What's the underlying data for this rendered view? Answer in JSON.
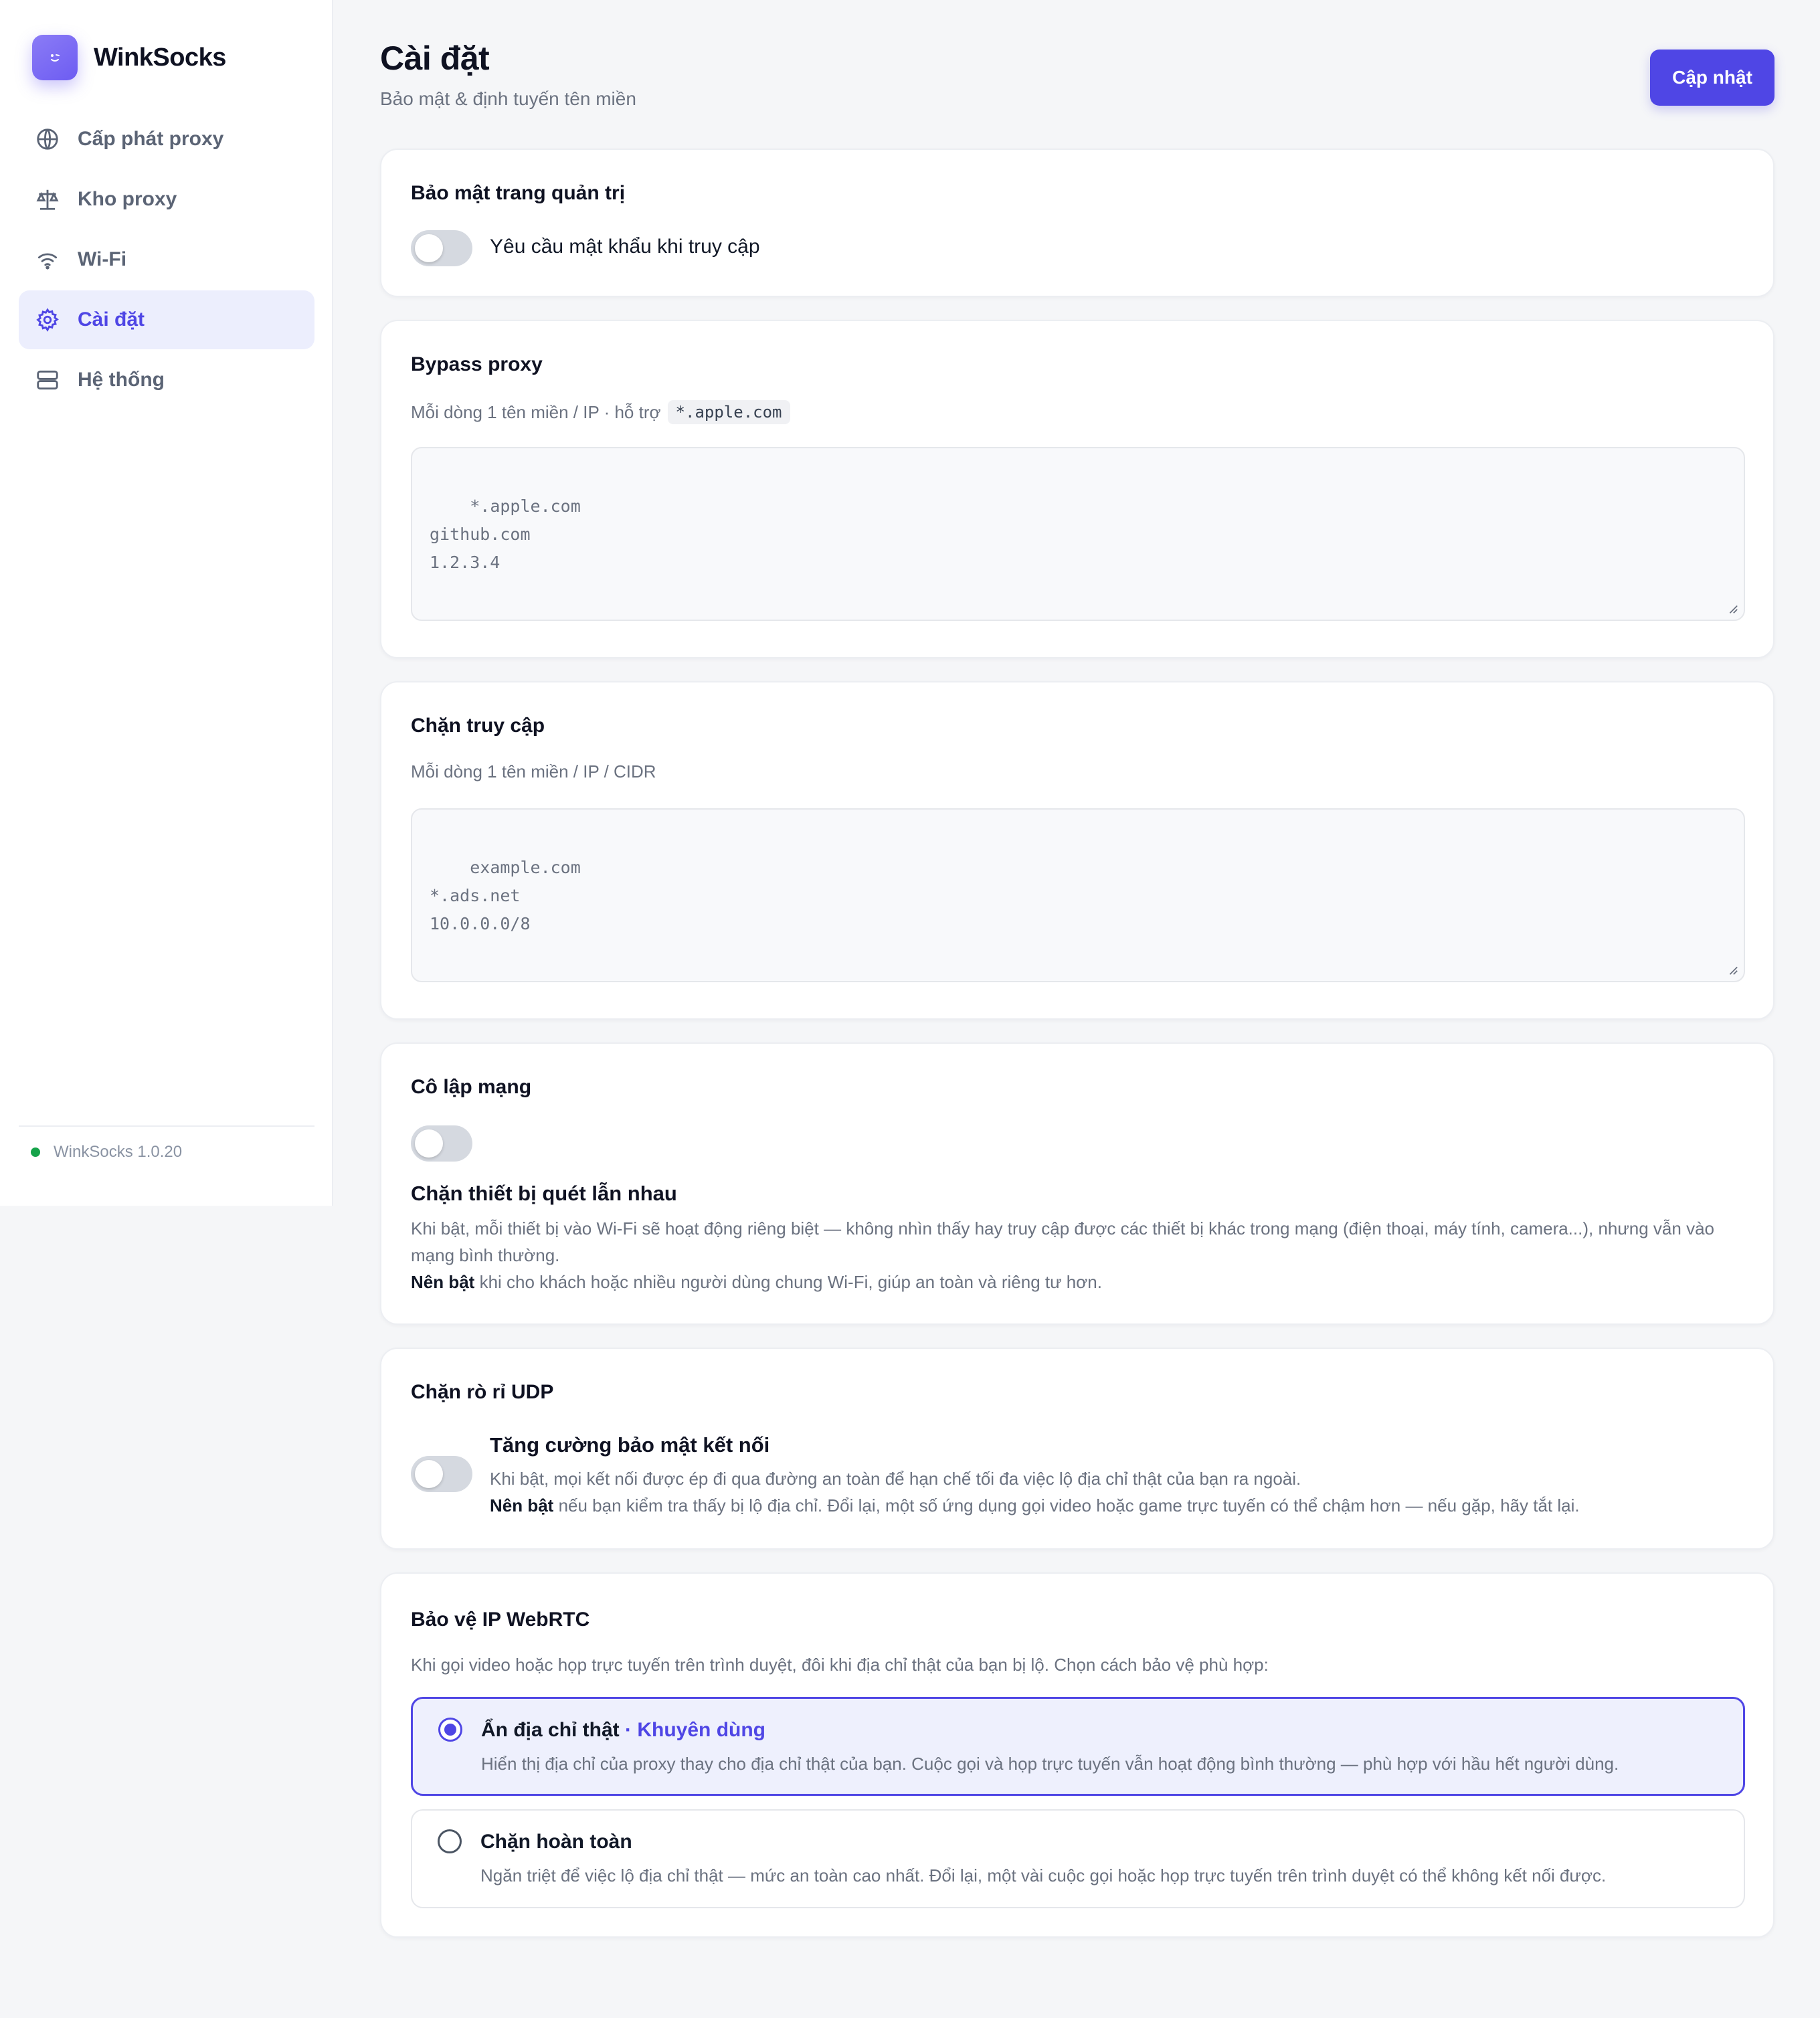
{
  "brand": {
    "name": "WinkSocks",
    "logo_icon": "wink-face-icon"
  },
  "sidebar": {
    "items": [
      {
        "label": "Cấp phát proxy",
        "icon": "globe-icon",
        "active": false
      },
      {
        "label": "Kho proxy",
        "icon": "scale-icon",
        "active": false
      },
      {
        "label": "Wi-Fi",
        "icon": "wifi-icon",
        "active": false
      },
      {
        "label": "Cài đặt",
        "icon": "gear-icon",
        "active": true
      },
      {
        "label": "Hệ thống",
        "icon": "server-icon",
        "active": false
      }
    ],
    "version": "WinkSocks 1.0.20",
    "status_color": "#16a34a"
  },
  "header": {
    "title": "Cài đặt",
    "subtitle": "Bảo mật & định tuyến tên miền",
    "update_label": "Cập nhật"
  },
  "admin_security": {
    "title": "Bảo mật trang quản trị",
    "toggle_label": "Yêu cầu mật khẩu khi truy cập",
    "enabled": false
  },
  "bypass": {
    "title": "Bypass proxy",
    "hint": "Mỗi dòng 1 tên miền / IP · hỗ trợ",
    "hint_code": "*.apple.com",
    "placeholder": "*.apple.com\ngithub.com\n1.2.3.4"
  },
  "block": {
    "title": "Chặn truy cập",
    "hint": "Mỗi dòng 1 tên miền / IP / CIDR",
    "placeholder": "example.com\n*.ads.net\n10.0.0.0/8"
  },
  "isolation": {
    "title": "Cô lập mạng",
    "enabled": false,
    "subtitle": "Chặn thiết bị quét lẫn nhau",
    "desc": "Khi bật, mỗi thiết bị vào Wi-Fi sẽ hoạt động riêng biệt — không nhìn thấy hay truy cập được các thiết bị khác trong mạng (điện thoại, máy tính, camera...), nhưng vẫn vào mạng bình thường.",
    "rec_bold": "Nên bật",
    "rec_text": " khi cho khách hoặc nhiều người dùng chung Wi-Fi, giúp an toàn và riêng tư hơn."
  },
  "udp": {
    "title": "Chặn rò rỉ UDP",
    "enabled": false,
    "subtitle": "Tăng cường bảo mật kết nối",
    "desc": "Khi bật, mọi kết nối được ép đi qua đường an toàn để hạn chế tối đa việc lộ địa chỉ thật của bạn ra ngoài.",
    "rec_bold": "Nên bật",
    "rec_text": " nếu bạn kiểm tra thấy bị lộ địa chỉ. Đổi lại, một số ứng dụng gọi video hoặc game trực tuyến có thể chậm hơn — nếu gặp, hãy tắt lại."
  },
  "webrtc": {
    "title": "Bảo vệ IP WebRTC",
    "intro": "Khi gọi video hoặc họp trực tuyến trên trình duyệt, đôi khi địa chỉ thật của bạn bị lộ. Chọn cách bảo vệ phù hợp:",
    "options": [
      {
        "title": "Ẩn địa chỉ thật",
        "badge": " · Khuyên dùng",
        "desc": "Hiển thị địa chỉ của proxy thay cho địa chỉ thật của bạn. Cuộc gọi và họp trực tuyến vẫn hoạt động bình thường — phù hợp với hầu hết người dùng.",
        "selected": true
      },
      {
        "title": "Chặn hoàn toàn",
        "desc": "Ngăn triệt để việc lộ địa chỉ thật — mức an toàn cao nhất. Đổi lại, một vài cuộc gọi hoặc họp trực tuyến trên trình duyệt có thể không kết nối được.",
        "selected": false
      }
    ]
  },
  "colors": {
    "accent": "#4f46e5",
    "accent_soft": "#eceefd",
    "toggle_off": "#d5d9e0"
  }
}
